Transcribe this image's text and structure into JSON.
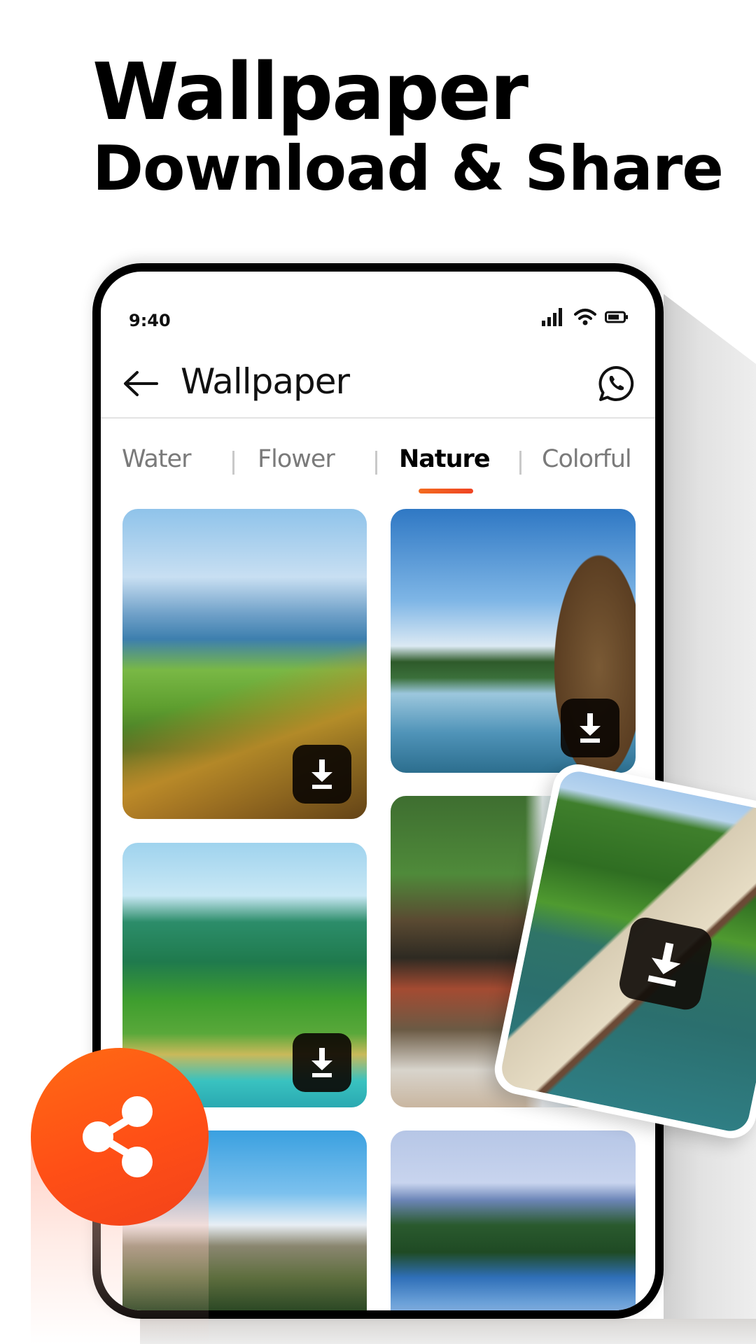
{
  "headline": {
    "title": "Wallpaper",
    "subtitle": "Download & Share"
  },
  "status_bar": {
    "time": "9:40",
    "icons": [
      "signal-icon",
      "wifi-icon",
      "battery-icon"
    ]
  },
  "app_bar": {
    "back_icon": "arrow-left-icon",
    "title": "Wallpaper",
    "action_icon": "whatsapp-icon"
  },
  "tabs": {
    "items": [
      {
        "label": "Water",
        "active": false
      },
      {
        "label": "Flower",
        "active": false
      },
      {
        "label": "Nature",
        "active": true
      },
      {
        "label": "Colorful",
        "active": false
      }
    ],
    "accent_color": "#F0501E"
  },
  "gallery": {
    "tiles": [
      {
        "subject": "alpine valley with autumn forest",
        "has_download": true
      },
      {
        "subject": "mountain lake with tree trunk",
        "has_download": true
      },
      {
        "subject": "karst mountains and waterfalls",
        "has_download": true
      },
      {
        "subject": "forest waterfall",
        "has_download": false
      },
      {
        "subject": "snowy mountain meadow with hikers",
        "has_download": false
      },
      {
        "subject": "pine tree by lake",
        "has_download": false
      }
    ],
    "download_icon": "download-icon"
  },
  "floating_card": {
    "subject": "road along river through forest",
    "download_icon": "download-icon"
  },
  "share_button": {
    "icon": "share-icon",
    "color": "#FF5A16"
  }
}
